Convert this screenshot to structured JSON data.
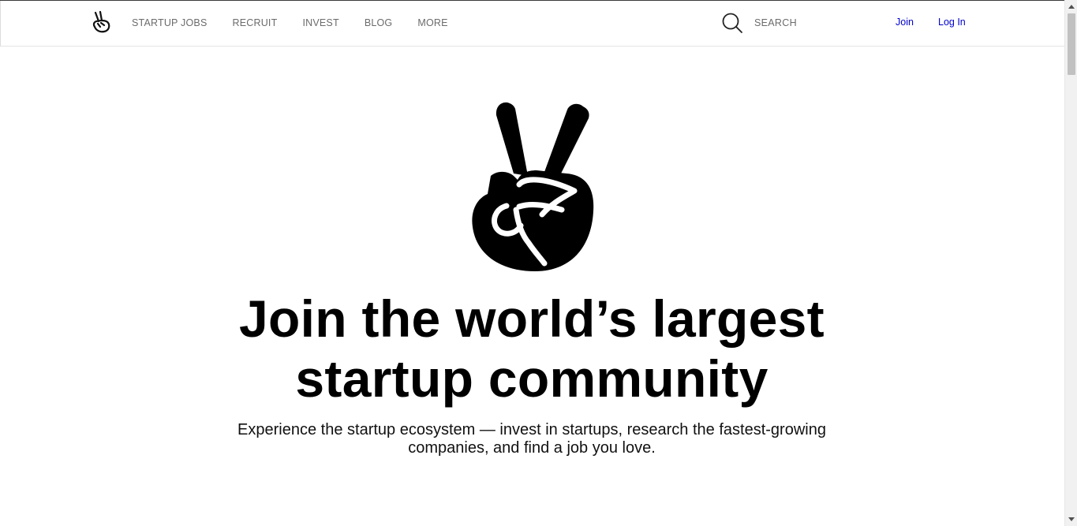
{
  "brand": {
    "logo_icon": "victory-hand-icon"
  },
  "nav": {
    "items": [
      {
        "label": "STARTUP JOBS"
      },
      {
        "label": "RECRUIT"
      },
      {
        "label": "INVEST"
      },
      {
        "label": "BLOG"
      },
      {
        "label": "MORE"
      }
    ]
  },
  "search": {
    "icon": "search-icon",
    "placeholder": "SEARCH"
  },
  "auth": {
    "join_label": "Join",
    "login_label": "Log In",
    "link_color": "#0000cc"
  },
  "hero": {
    "logo_icon": "victory-hand-icon",
    "headline_line1": "Join the world’s largest",
    "headline_line2": "startup community",
    "subtitle_line1": "Experience the startup ecosystem — invest in startups, research the fastest-growing",
    "subtitle_line2": "companies, and find a job you love."
  }
}
